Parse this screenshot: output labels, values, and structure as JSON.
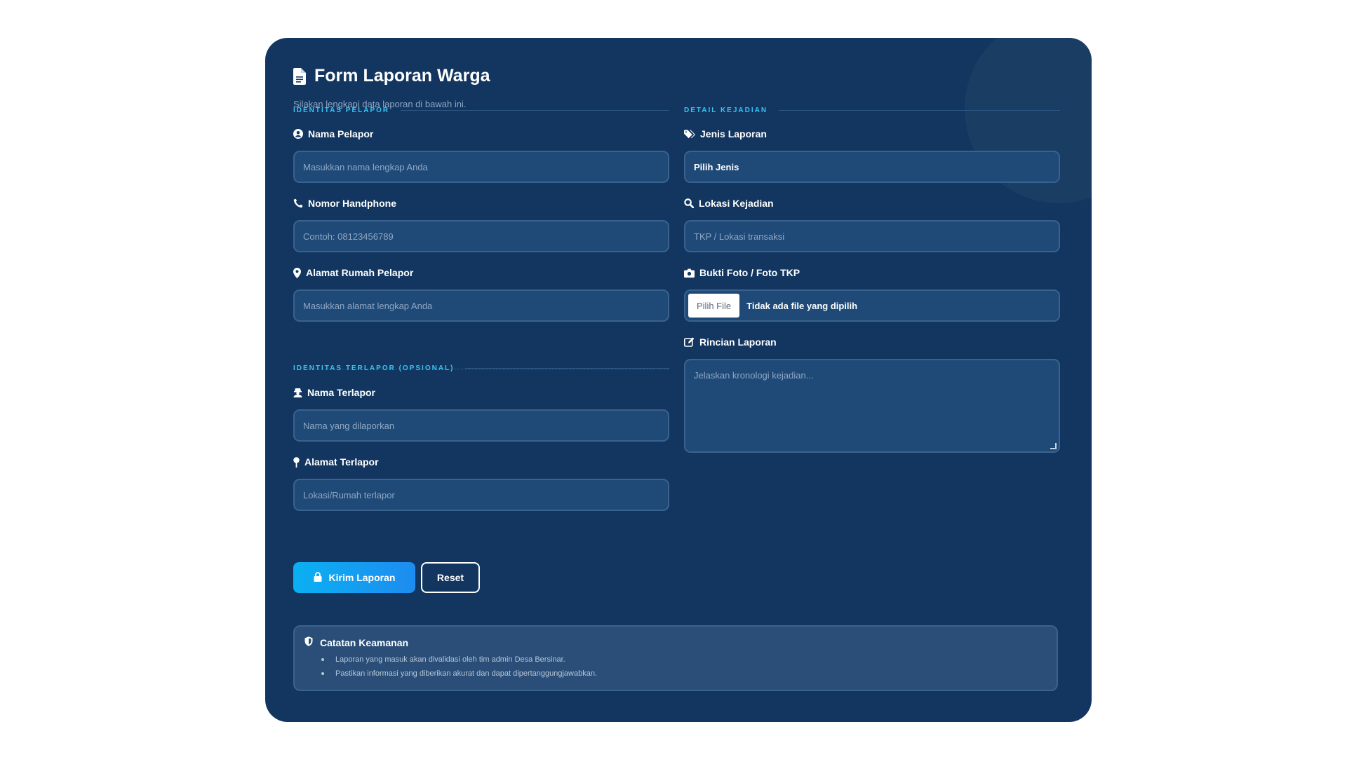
{
  "form": {
    "title": "Form Laporan Warga",
    "subtitle": "Silakan lengkapi data laporan di bawah ini."
  },
  "sections": {
    "pelapor": "IDENTITAS PELAPOR",
    "kejadian": "DETAIL KEJADIAN",
    "terlapor": "IDENTITAS TERLAPOR (OPSIONAL)"
  },
  "fields": {
    "nama_pelapor": {
      "label": "Nama Pelapor",
      "placeholder": "Masukkan nama lengkap Anda"
    },
    "nomor_hp": {
      "label": "Nomor Handphone",
      "placeholder": "Contoh: 08123456789"
    },
    "alamat_pelapor": {
      "label": "Alamat Rumah Pelapor",
      "placeholder": "Masukkan alamat lengkap Anda"
    },
    "nama_terlapor": {
      "label": "Nama Terlapor",
      "placeholder": "Nama yang dilaporkan"
    },
    "alamat_terlapor": {
      "label": "Alamat Terlapor",
      "placeholder": "Lokasi/Rumah terlapor"
    },
    "jenis_laporan": {
      "label": "Jenis Laporan",
      "value": "Pilih Jenis"
    },
    "lokasi_kejadian": {
      "label": "Lokasi Kejadian",
      "placeholder": "TKP / Lokasi transaksi"
    },
    "bukti_foto": {
      "label": "Bukti Foto / Foto TKP",
      "button": "Pilih File",
      "status": "Tidak ada file yang dipilih"
    },
    "rincian": {
      "label": "Rincian Laporan",
      "placeholder": "Jelaskan kronologi kejadian..."
    }
  },
  "actions": {
    "submit": "Kirim Laporan",
    "reset": "Reset"
  },
  "note": {
    "title": "Catatan Keamanan",
    "items": [
      "Laporan yang masuk akan divalidasi oleh tim admin Desa Bersinar.",
      "Pastikan informasi yang diberikan akurat dan dapat dipertanggungjawabkan."
    ]
  },
  "colors": {
    "card_bg": "#12365f",
    "input_bg": "#1f4a78",
    "accent": "#35c4f6",
    "primary_button": "#0bb0f2"
  },
  "icons": {
    "title": "document-icon",
    "nama_pelapor": "user-circle-icon",
    "nomor_hp": "phone-icon",
    "alamat_pelapor": "map-pin-icon",
    "nama_terlapor": "user-secret-icon",
    "alamat_terlapor": "thumbtack-icon",
    "jenis_laporan": "tags-icon",
    "lokasi_kejadian": "search-icon",
    "bukti_foto": "camera-icon",
    "rincian": "edit-icon",
    "submit": "lock-icon",
    "note": "shield-icon"
  }
}
